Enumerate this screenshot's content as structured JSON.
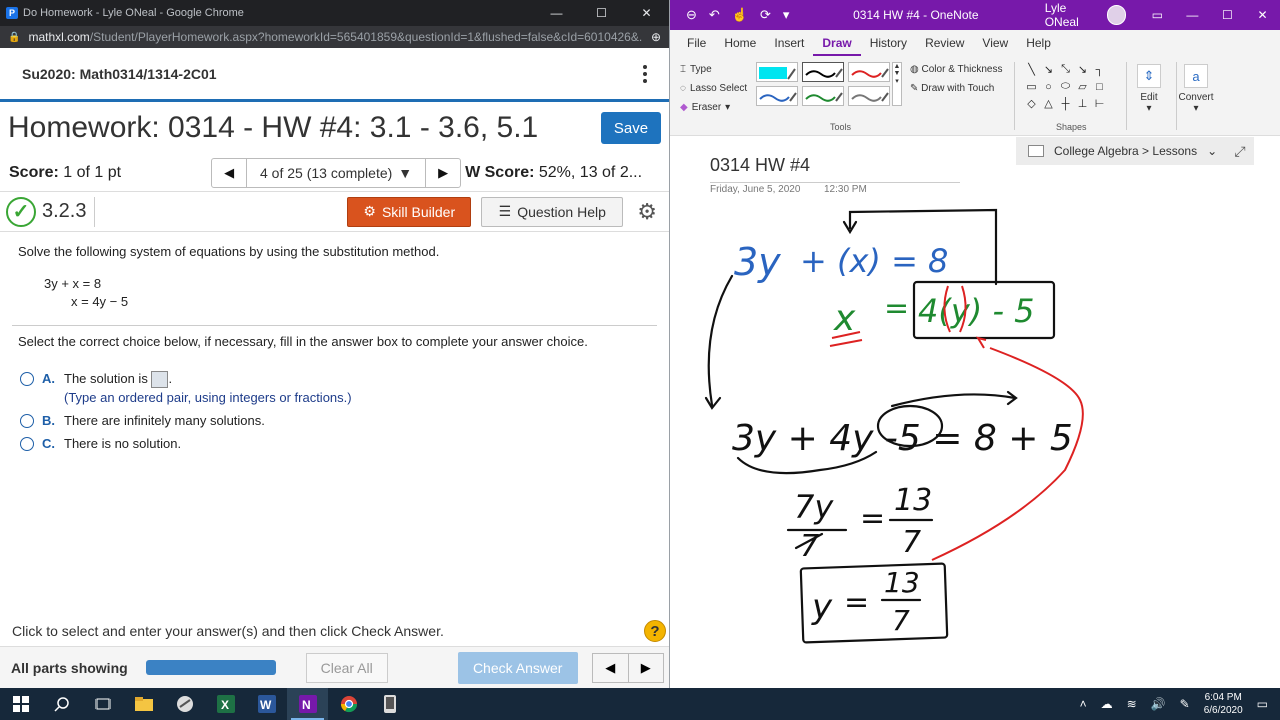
{
  "chrome": {
    "window_title": "Do Homework - Lyle ONeal - Google Chrome",
    "url_host": "mathxl.com",
    "url_path": "/Student/PlayerHomework.aspx?homeworkId=565401859&questionId=1&flushed=false&cId=6010426&..."
  },
  "mxl": {
    "course": "Su2020: Math0314/1314-2C01",
    "hw_title": "Homework: 0314 - HW #4: 3.1 - 3.6, 5.1",
    "save_label": "Save",
    "score_label": "Score:",
    "score_value": "1 of 1 pt",
    "question_position": "4 of 25 (13 complete)",
    "hw_score_label": "W Score:",
    "hw_score_value": "52%, 13 of 2...",
    "question_number": "3.2.3",
    "skill_builder": "Skill Builder",
    "question_help": "Question Help",
    "instruction": "Solve the following system of equations by using the substitution method.",
    "eq1": "3y + x = 8",
    "eq2": "x = 4y − 5",
    "choice_intro": "Select the correct choice below, if necessary, fill in the answer box to complete your answer choice.",
    "choices": [
      {
        "letter": "A.",
        "text_before": "The solution is",
        "text_after": ".",
        "hint": "(Type an ordered pair, using integers or fractions.)"
      },
      {
        "letter": "B.",
        "text": "There are infinitely many solutions."
      },
      {
        "letter": "C.",
        "text": "There is no solution."
      }
    ],
    "footer_hint": "Click to select and enter your answer(s) and then click Check Answer.",
    "help_icon_glyph": "?",
    "all_parts": "All parts showing",
    "clear_all": "Clear All",
    "check_answer": "Check Answer",
    "accent_blue": "#1e73be",
    "skill_orange": "#d9531e"
  },
  "onenote": {
    "doc_title": "0314 HW #4  -  OneNote",
    "user": "Lyle ONeal",
    "tabs": [
      "File",
      "Home",
      "Insert",
      "Draw",
      "History",
      "Review",
      "View",
      "Help"
    ],
    "active_tab": "Draw",
    "tool_type": "Type",
    "tool_lasso": "Lasso Select",
    "tool_eraser": "Eraser",
    "color_thickness": "Color & Thickness",
    "draw_touch": "Draw with Touch",
    "group_tools": "Tools",
    "group_shapes": "Shapes",
    "edit": "Edit",
    "convert": "Convert",
    "notebook": "College Algebra > Lessons",
    "page_title": "0314 HW #4",
    "page_date": "Friday, June 5, 2020",
    "page_time": "12:30 PM",
    "brand_purple": "#7719aa"
  },
  "ink": {
    "line1_a": "3y",
    "line1_b": "+ (x) = 8",
    "line2_x": "x",
    "line2_eq": "=",
    "line2_box": "4(y) - 5",
    "line3": "3y + 4y -5 = 8 + 5",
    "frac_num1": "7y",
    "frac_eq1": "=",
    "frac_num2": "13",
    "frac_den1": "7",
    "frac_den2": "7",
    "result_y": "y",
    "result_eq": "=",
    "result_num": "13",
    "result_den": "7"
  },
  "taskbar": {
    "time": "6:04 PM",
    "date": "6/6/2020",
    "apps": [
      "start",
      "search",
      "task-view",
      "file-explorer",
      "snip",
      "excel",
      "word",
      "onenote",
      "chrome",
      "phone"
    ]
  }
}
